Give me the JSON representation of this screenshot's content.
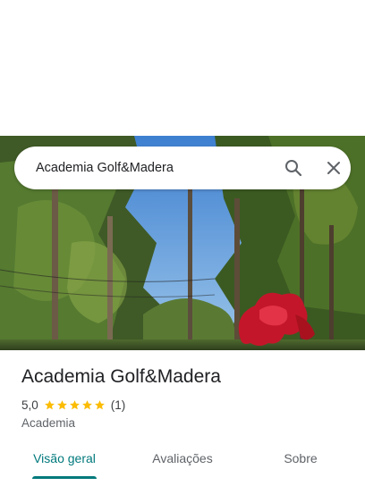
{
  "search": {
    "query": "Academia Golf&Madera"
  },
  "place": {
    "title": "Academia Golf&Madera",
    "rating": "5,0",
    "stars": 5,
    "review_count": "(1)",
    "category": "Academia"
  },
  "tabs": [
    {
      "label": "Visão geral",
      "active": true
    },
    {
      "label": "Avaliações",
      "active": false
    },
    {
      "label": "Sobre",
      "active": false
    }
  ],
  "colors": {
    "accent": "#00797c",
    "star": "#fbbc04",
    "text_primary": "#202124",
    "text_secondary": "#5f6368"
  },
  "icons": {
    "search": "search-icon",
    "close": "close-icon",
    "star": "star-icon"
  }
}
